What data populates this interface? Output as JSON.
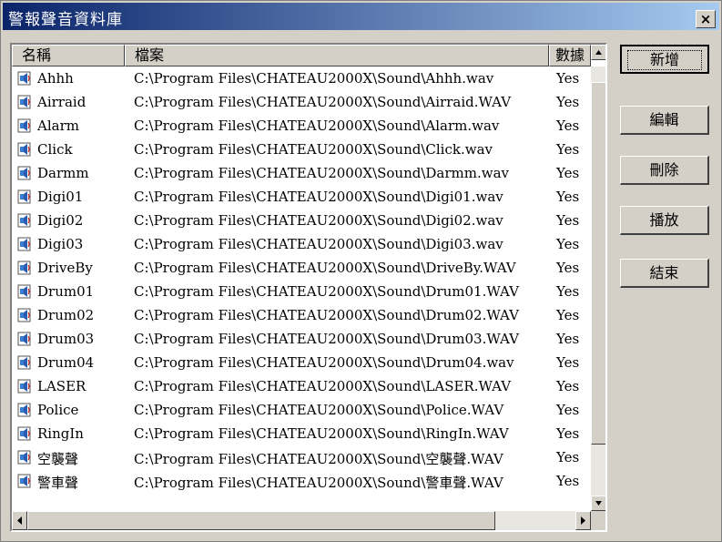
{
  "window": {
    "title": "警報聲音資料庫",
    "close_label": "×"
  },
  "list": {
    "columns": [
      "名稱",
      "檔案",
      "數據"
    ],
    "rows": [
      {
        "name": "Ahhh",
        "file": "C:\\Program Files\\CHATEAU2000X\\Sound\\Ahhh.wav",
        "flag": "Yes"
      },
      {
        "name": "Airraid",
        "file": "C:\\Program Files\\CHATEAU2000X\\Sound\\Airraid.WAV",
        "flag": "Yes"
      },
      {
        "name": "Alarm",
        "file": "C:\\Program Files\\CHATEAU2000X\\Sound\\Alarm.wav",
        "flag": "Yes"
      },
      {
        "name": "Click",
        "file": "C:\\Program Files\\CHATEAU2000X\\Sound\\Click.wav",
        "flag": "Yes"
      },
      {
        "name": "Darmm",
        "file": "C:\\Program Files\\CHATEAU2000X\\Sound\\Darmm.wav",
        "flag": "Yes"
      },
      {
        "name": "Digi01",
        "file": "C:\\Program Files\\CHATEAU2000X\\Sound\\Digi01.wav",
        "flag": "Yes"
      },
      {
        "name": "Digi02",
        "file": "C:\\Program Files\\CHATEAU2000X\\Sound\\Digi02.wav",
        "flag": "Yes"
      },
      {
        "name": "Digi03",
        "file": "C:\\Program Files\\CHATEAU2000X\\Sound\\Digi03.wav",
        "flag": "Yes"
      },
      {
        "name": "DriveBy",
        "file": "C:\\Program Files\\CHATEAU2000X\\Sound\\DriveBy.WAV",
        "flag": "Yes"
      },
      {
        "name": "Drum01",
        "file": "C:\\Program Files\\CHATEAU2000X\\Sound\\Drum01.WAV",
        "flag": "Yes"
      },
      {
        "name": "Drum02",
        "file": "C:\\Program Files\\CHATEAU2000X\\Sound\\Drum02.WAV",
        "flag": "Yes"
      },
      {
        "name": "Drum03",
        "file": "C:\\Program Files\\CHATEAU2000X\\Sound\\Drum03.WAV",
        "flag": "Yes"
      },
      {
        "name": "Drum04",
        "file": "C:\\Program Files\\CHATEAU2000X\\Sound\\Drum04.wav",
        "flag": "Yes"
      },
      {
        "name": "LASER",
        "file": "C:\\Program Files\\CHATEAU2000X\\Sound\\LASER.WAV",
        "flag": "Yes"
      },
      {
        "name": "Police",
        "file": "C:\\Program Files\\CHATEAU2000X\\Sound\\Police.WAV",
        "flag": "Yes"
      },
      {
        "name": "RingIn",
        "file": "C:\\Program Files\\CHATEAU2000X\\Sound\\RingIn.WAV",
        "flag": "Yes"
      },
      {
        "name": "空襲聲",
        "file": "C:\\Program Files\\CHATEAU2000X\\Sound\\空襲聲.WAV",
        "flag": "Yes"
      },
      {
        "name": "警車聲",
        "file": "C:\\Program Files\\CHATEAU2000X\\Sound\\警車聲.WAV",
        "flag": "Yes"
      }
    ]
  },
  "buttons": {
    "add": "新增",
    "edit": "編輯",
    "delete": "刪除",
    "play": "播放",
    "close": "結束"
  },
  "colors": {
    "titlebar_start": "#0a246a",
    "titlebar_end": "#a6caf0",
    "face": "#d4d0c8"
  }
}
